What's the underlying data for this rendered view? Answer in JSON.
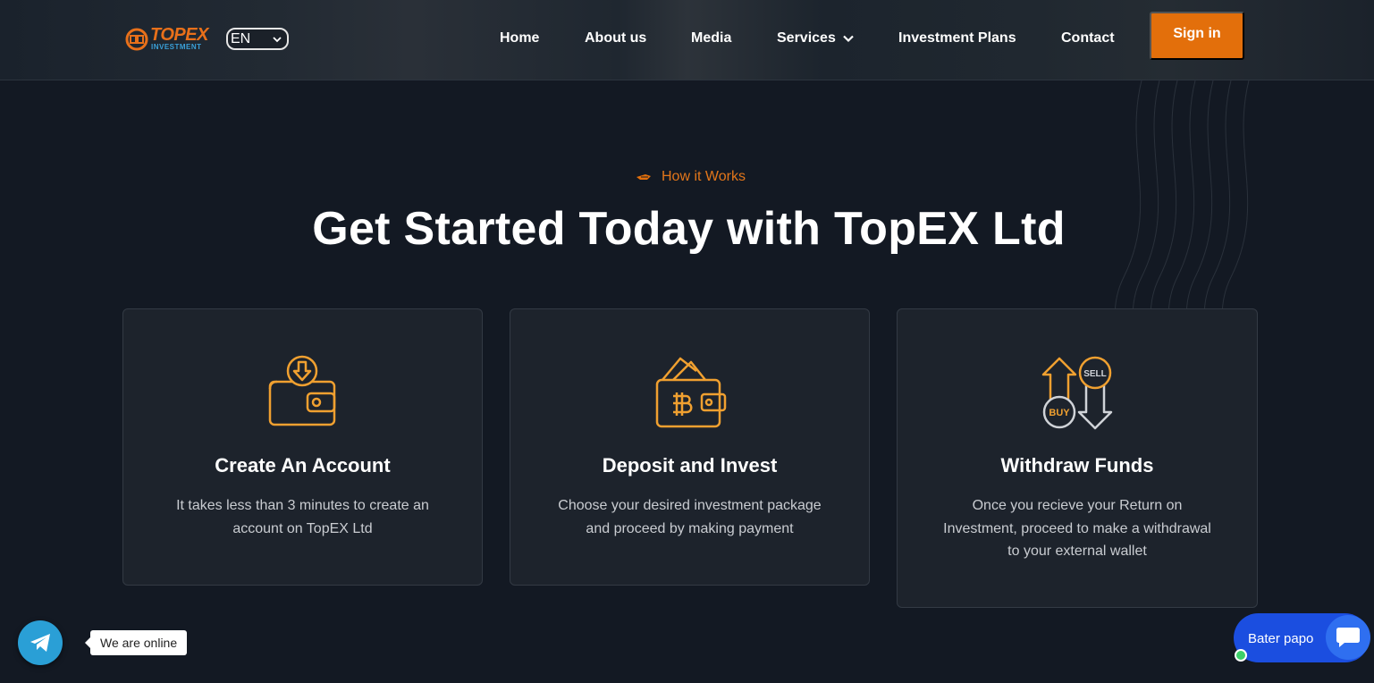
{
  "header": {
    "logo_word": "TOPEX",
    "logo_sub": "INVESTMENT",
    "language": "EN",
    "nav": [
      {
        "label": "Home"
      },
      {
        "label": "About us"
      },
      {
        "label": "Media"
      },
      {
        "label": "Services"
      },
      {
        "label": "Investment Plans"
      },
      {
        "label": "Contact"
      }
    ],
    "signin_label": "Sign in"
  },
  "section": {
    "eyebrow": "How it Works",
    "title": "Get Started Today with TopEX Ltd"
  },
  "cards": [
    {
      "icon": "wallet-download-icon",
      "title": "Create An Account",
      "desc": "It takes less than 3 minutes to create an account on TopEX Ltd"
    },
    {
      "icon": "bitcoin-wallet-icon",
      "title": "Deposit and Invest",
      "desc": "Choose your desired investment package and proceed by making payment"
    },
    {
      "icon": "buy-sell-arrows-icon",
      "title": "Withdraw Funds",
      "desc": "Once you recieve your Return on Investment, proceed to make a withdrawal to your external wallet"
    }
  ],
  "telegram": {
    "tooltip": "We are online"
  },
  "chat": {
    "label": "Bater papo"
  },
  "colors": {
    "accent": "#e36f0b",
    "background": "#131923",
    "card": "#1d232c",
    "chat": "#1b4ee0",
    "telegram": "#2a9fd6"
  }
}
